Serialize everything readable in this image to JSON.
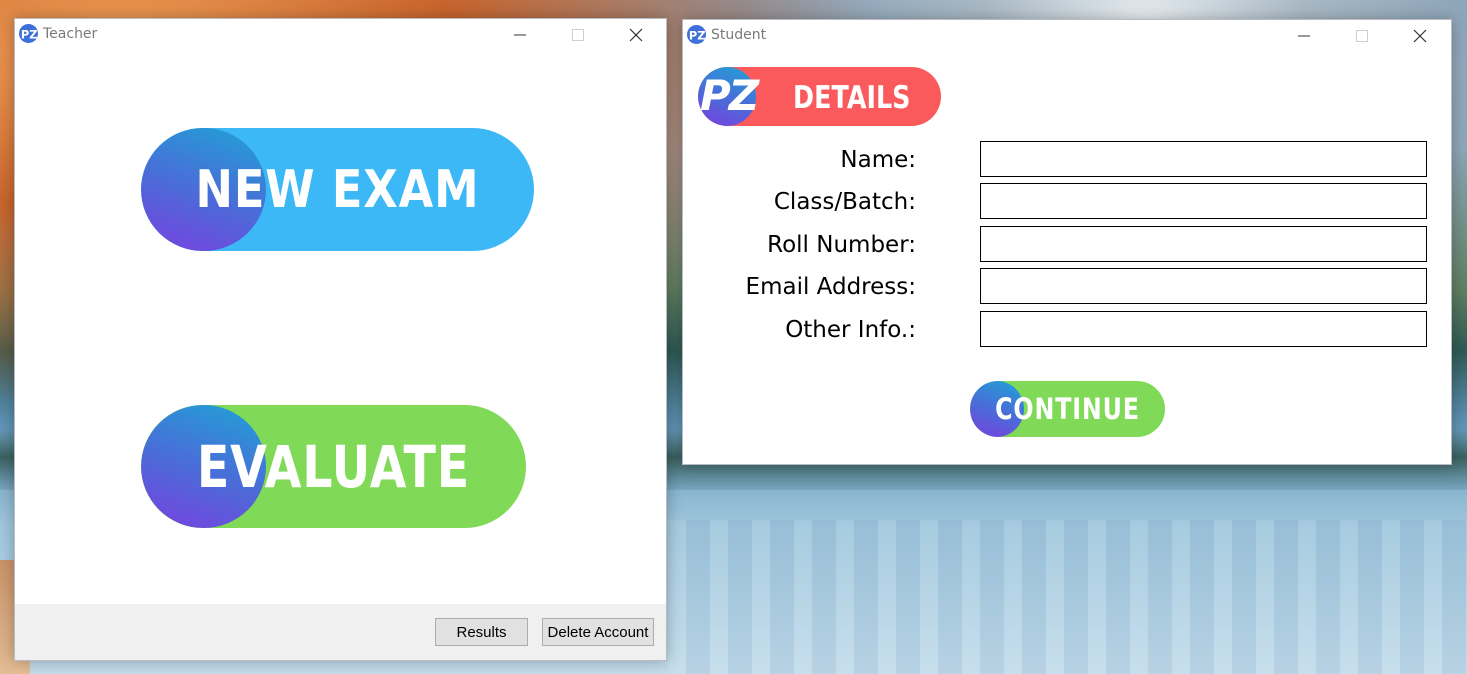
{
  "teacher_window": {
    "title": "Teacher",
    "new_exam_label": "NEW EXAM",
    "evaluate_label": "EVALUATE",
    "results_label": "Results",
    "delete_account_label": "Delete Account"
  },
  "student_window": {
    "title": "Student",
    "logo_text": "PZ",
    "details_label": "DETAILS",
    "fields": [
      {
        "label": "Name:",
        "value": ""
      },
      {
        "label": "Class/Batch:",
        "value": ""
      },
      {
        "label": "Roll Number:",
        "value": ""
      },
      {
        "label": "Email Address:",
        "value": ""
      },
      {
        "label": "Other Info.:",
        "value": ""
      }
    ],
    "continue_label": "CONTINUE"
  },
  "colors": {
    "new_exam": "#3db8f7",
    "evaluate": "#80d957",
    "details": "#fb5a5d",
    "continue": "#80d957"
  },
  "icons": {
    "app": "pz-logo-icon",
    "minimize": "minimize-icon",
    "maximize": "maximize-icon",
    "close": "close-icon"
  }
}
